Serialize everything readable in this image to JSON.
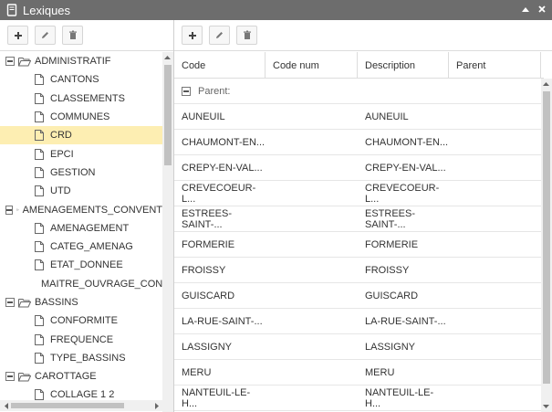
{
  "window": {
    "title": "Lexiques",
    "icon": "book-icon"
  },
  "left_toolbar": {
    "buttons": [
      "plus-icon",
      "pencil-icon",
      "trash-icon"
    ]
  },
  "right_toolbar": {
    "buttons": [
      "plus-icon",
      "pencil-icon",
      "trash-icon"
    ]
  },
  "tree": {
    "categories": [
      {
        "label": "ADMINISTRATIF",
        "items": [
          "CANTONS",
          "CLASSEMENTS",
          "COMMUNES",
          "CRD",
          "EPCI",
          "GESTION",
          "UTD"
        ]
      },
      {
        "label": "AMENAGEMENTS_CONVENT",
        "items": [
          "AMENAGEMENT",
          "CATEG_AMENAG",
          "ETAT_DONNEE",
          "MAITRE_OUVRAGE_CON"
        ]
      },
      {
        "label": "BASSINS",
        "items": [
          "CONFORMITE",
          "FREQUENCE",
          "TYPE_BASSINS"
        ]
      },
      {
        "label": "CAROTTAGE",
        "items": [
          "COLLAGE 1 2"
        ]
      }
    ],
    "selected": "CRD"
  },
  "grid": {
    "columns": [
      "Code",
      "Code num",
      "Description",
      "Parent"
    ],
    "group_label": "Parent:",
    "rows": [
      [
        "AUNEUIL",
        "",
        "AUNEUIL",
        ""
      ],
      [
        "CHAUMONT-EN...",
        "",
        "CHAUMONT-EN...",
        ""
      ],
      [
        "CREPY-EN-VAL...",
        "",
        "CREPY-EN-VAL...",
        ""
      ],
      [
        "CREVECOEUR-L...",
        "",
        "CREVECOEUR-L...",
        ""
      ],
      [
        "ESTREES-SAINT-...",
        "",
        "ESTREES-SAINT-...",
        ""
      ],
      [
        "FORMERIE",
        "",
        "FORMERIE",
        ""
      ],
      [
        "FROISSY",
        "",
        "FROISSY",
        ""
      ],
      [
        "GUISCARD",
        "",
        "GUISCARD",
        ""
      ],
      [
        "LA-RUE-SAINT-...",
        "",
        "LA-RUE-SAINT-...",
        ""
      ],
      [
        "LASSIGNY",
        "",
        "LASSIGNY",
        ""
      ],
      [
        "MERU",
        "",
        "MERU",
        ""
      ],
      [
        "NANTEUIL-LE-H...",
        "",
        "NANTEUIL-LE-H...",
        ""
      ]
    ]
  },
  "colors": {
    "titlebar": "#6d6d6d",
    "selection": "#fdeeb2",
    "header_border": "#dcdcdc"
  }
}
